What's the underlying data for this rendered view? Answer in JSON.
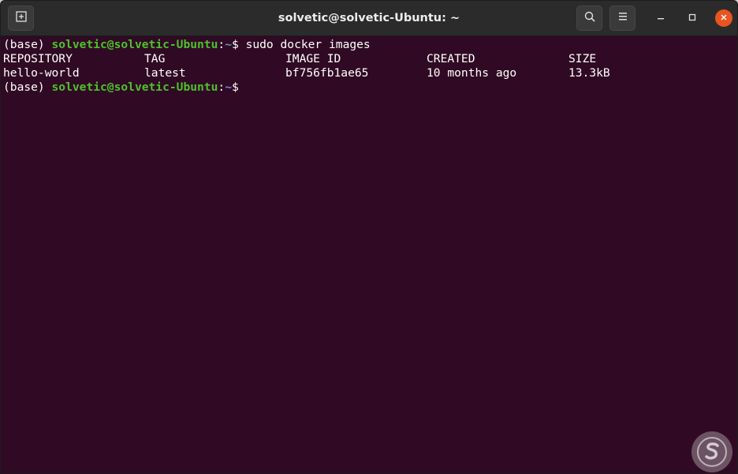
{
  "window": {
    "title": "solvetic@solvetic-Ubuntu: ~",
    "accent_close": "#e95420",
    "terminal_bg": "#300a24",
    "prompt_user_color": "#4cc22b",
    "prompt_dir_color": "#6a8fd6"
  },
  "titlebar": {
    "new_tab_icon": "new-tab-icon",
    "search_icon": "search-icon",
    "menu_icon": "hamburger-menu-icon",
    "minimize_icon": "minimize-icon",
    "maximize_icon": "maximize-icon",
    "close_icon": "close-icon"
  },
  "terminal": {
    "prompt1": {
      "env": "(base) ",
      "user": "solvetic@solvetic-Ubuntu",
      "sep": ":",
      "dir": "~",
      "sym": "$ ",
      "command": "sudo docker images"
    },
    "table": {
      "headers": [
        "REPOSITORY",
        "TAG",
        "IMAGE ID",
        "CREATED",
        "SIZE"
      ],
      "rows": [
        [
          "hello-world",
          "latest",
          "bf756fb1ae65",
          "10 months ago",
          "13.3kB"
        ]
      ]
    },
    "prompt2": {
      "env": "(base) ",
      "user": "solvetic@solvetic-Ubuntu",
      "sep": ":",
      "dir": "~",
      "sym": "$ "
    }
  },
  "watermark": {
    "icon": "logo-watermark-icon"
  }
}
